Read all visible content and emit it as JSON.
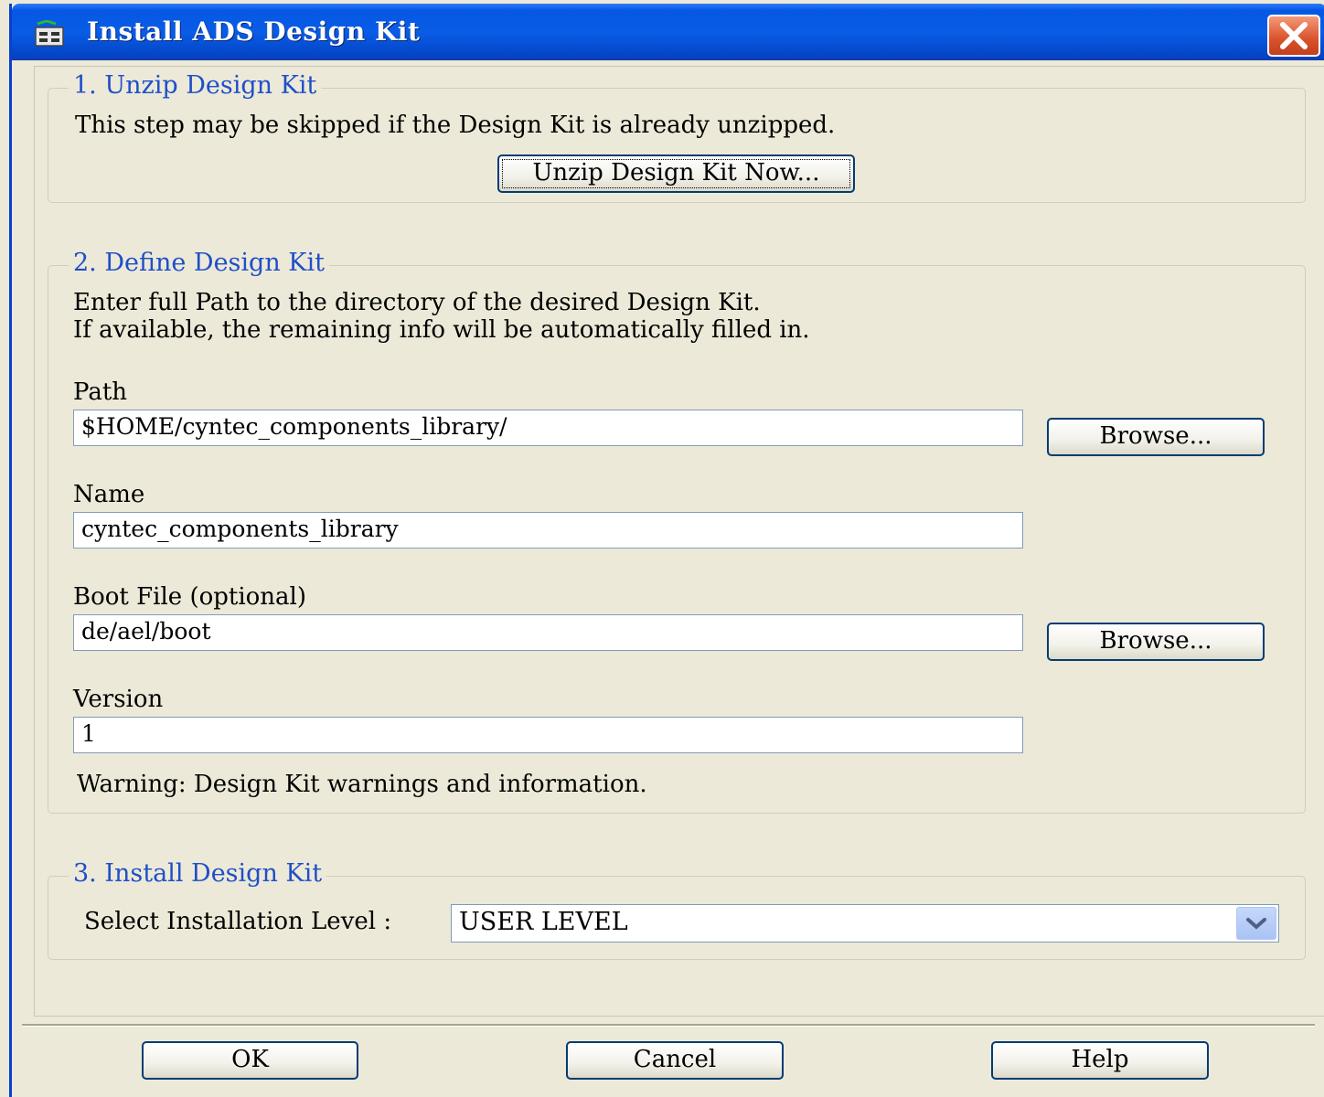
{
  "window": {
    "title": "Install ADS Design Kit",
    "titlebar_color": "#0A5CE6",
    "close_color": "#D9512B"
  },
  "step1": {
    "legend": "1. Unzip Design Kit",
    "description": "This step may be skipped if the Design Kit is already unzipped.",
    "unzip_button": "Unzip Design Kit Now..."
  },
  "step2": {
    "legend": "2. Define Design Kit",
    "description_line1": "Enter full Path to the directory of the desired Design Kit.",
    "description_line2": "If available, the remaining info will be automatically filled in.",
    "path_label": "Path",
    "path_value": "$HOME/cyntec_components_library/",
    "browse_label": "Browse...",
    "name_label": "Name",
    "name_value": "cyntec_components_library",
    "boot_label": "Boot File (optional)",
    "boot_value": "de/ael/boot",
    "version_label": "Version",
    "version_value": "1",
    "warning": "Warning: Design Kit warnings and information."
  },
  "step3": {
    "legend": "3. Install Design Kit",
    "level_label": "Select Installation Level :",
    "level_value": "USER LEVEL"
  },
  "footer": {
    "ok": "OK",
    "cancel": "Cancel",
    "help": "Help"
  },
  "colors": {
    "legend_text": "#1F4FC8",
    "dialog_bg": "#ECE9D8",
    "button_border": "#003C74"
  }
}
